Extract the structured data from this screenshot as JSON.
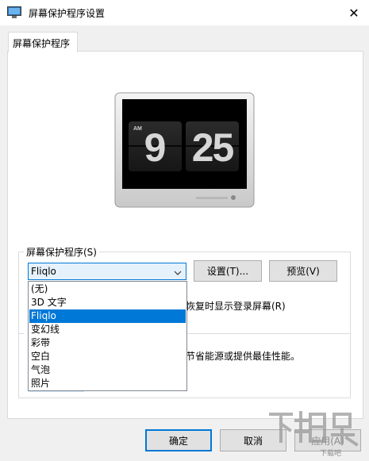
{
  "window": {
    "title": "屏幕保护程序设置",
    "close_glyph": "✕"
  },
  "tabs": [
    {
      "label": "屏幕保护程序",
      "selected": true
    }
  ],
  "preview": {
    "am_label": "AM",
    "hour": "9",
    "minute": "25"
  },
  "screensaver_group": {
    "label": "屏幕保护程序(S)",
    "selected_value": "Fliqlo",
    "settings_label": "设置(T)...",
    "preview_label": "预览(V)",
    "resume_text": "恢复时显示登录屏幕(R)"
  },
  "dropdown": {
    "options": [
      "(无)",
      "3D 文字",
      "Fliqlo",
      "变幻线",
      "彩带",
      "空白",
      "气泡",
      "照片"
    ],
    "selected_index": 2
  },
  "power_group": {
    "text": "节省能源或提供最佳性能。"
  },
  "footer": {
    "ok_label": "确定",
    "cancel_label": "取消",
    "apply_label": "应用(A)"
  },
  "watermark": {
    "text": "下载吧"
  },
  "colors": {
    "accent": "#0078d7",
    "combo_bg": "#e5f1fb",
    "dialog_bg": "#f0f0f0"
  }
}
